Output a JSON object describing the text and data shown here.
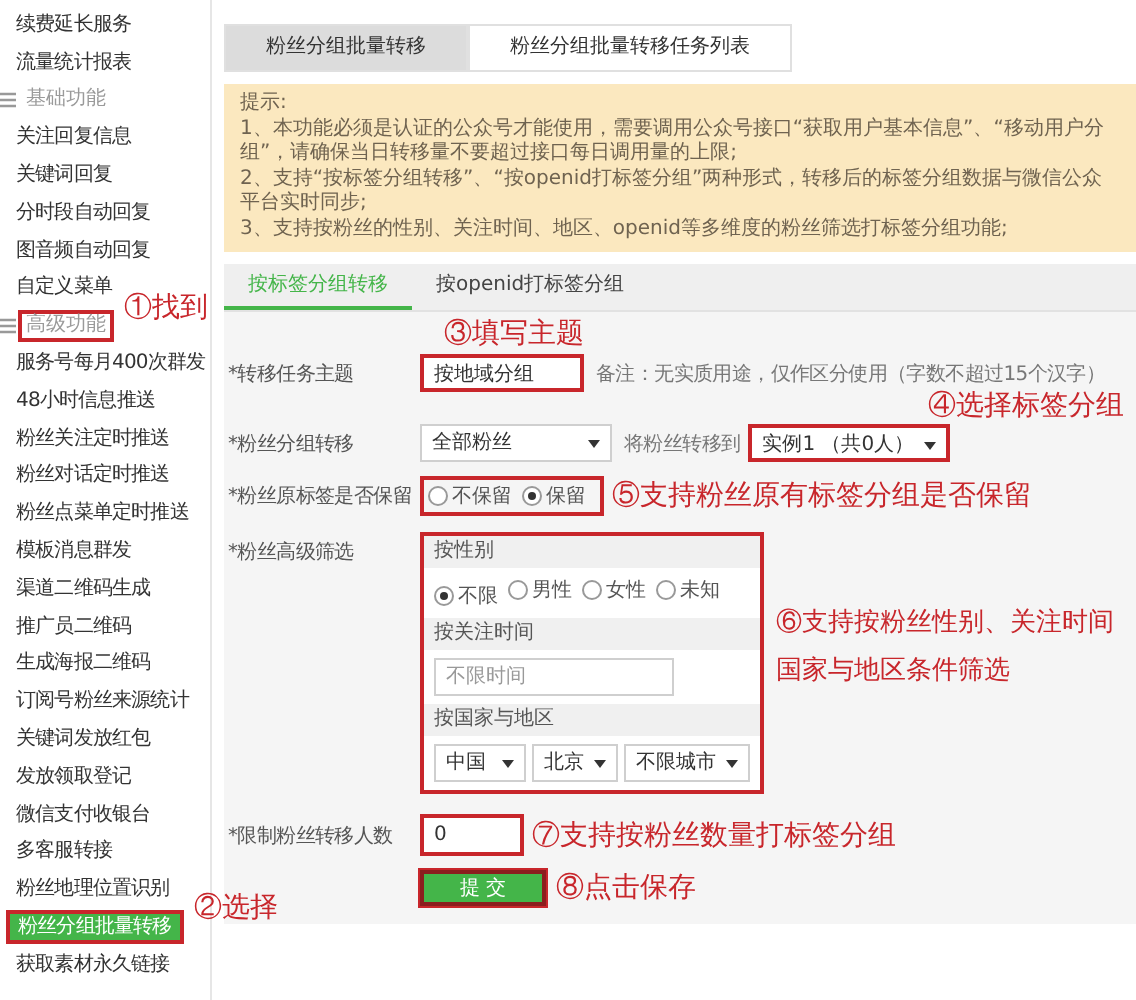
{
  "sidebar": {
    "items": [
      {
        "kind": "item",
        "label": "续费延长服务",
        "selected": false,
        "highlighted": false
      },
      {
        "kind": "item",
        "label": "流量统计报表",
        "selected": false,
        "highlighted": false
      },
      {
        "kind": "section",
        "label": "基础功能",
        "highlighted": false
      },
      {
        "kind": "item",
        "label": "关注回复信息",
        "selected": false,
        "highlighted": false
      },
      {
        "kind": "item",
        "label": "关键词回复",
        "selected": false,
        "highlighted": false
      },
      {
        "kind": "item",
        "label": "分时段自动回复",
        "selected": false,
        "highlighted": false
      },
      {
        "kind": "item",
        "label": "图音频自动回复",
        "selected": false,
        "highlighted": false
      },
      {
        "kind": "item",
        "label": "自定义菜单",
        "selected": false,
        "highlighted": false
      },
      {
        "kind": "section",
        "label": "高级功能",
        "highlighted": true,
        "annotation": "①找到"
      },
      {
        "kind": "item",
        "label": "服务号每月400次群发",
        "selected": false,
        "highlighted": false
      },
      {
        "kind": "item",
        "label": "48小时信息推送",
        "selected": false,
        "highlighted": false
      },
      {
        "kind": "item",
        "label": "粉丝关注定时推送",
        "selected": false,
        "highlighted": false
      },
      {
        "kind": "item",
        "label": "粉丝对话定时推送",
        "selected": false,
        "highlighted": false
      },
      {
        "kind": "item",
        "label": "粉丝点菜单定时推送",
        "selected": false,
        "highlighted": false
      },
      {
        "kind": "item",
        "label": "模板消息群发",
        "selected": false,
        "highlighted": false
      },
      {
        "kind": "item",
        "label": "渠道二维码生成",
        "selected": false,
        "highlighted": false
      },
      {
        "kind": "item",
        "label": "推广员二维码",
        "selected": false,
        "highlighted": false
      },
      {
        "kind": "item",
        "label": "生成海报二维码",
        "selected": false,
        "highlighted": false
      },
      {
        "kind": "item",
        "label": "订阅号粉丝来源统计",
        "selected": false,
        "highlighted": false
      },
      {
        "kind": "item",
        "label": "关键词发放红包",
        "selected": false,
        "highlighted": false
      },
      {
        "kind": "item",
        "label": "发放领取登记",
        "selected": false,
        "highlighted": false
      },
      {
        "kind": "item",
        "label": "微信支付收银台",
        "selected": false,
        "highlighted": false
      },
      {
        "kind": "item",
        "label": "多客服转接",
        "selected": false,
        "highlighted": false
      },
      {
        "kind": "item",
        "label": "粉丝地理位置识别",
        "selected": false,
        "highlighted": false
      },
      {
        "kind": "item",
        "label": "粉丝分组批量转移",
        "selected": true,
        "highlighted": true,
        "annotation": "②选择"
      },
      {
        "kind": "item",
        "label": "获取素材永久链接",
        "selected": false,
        "highlighted": false
      }
    ]
  },
  "tabs": [
    {
      "label": "粉丝分组批量转移",
      "selected": true
    },
    {
      "label": "粉丝分组批量转移任务列表",
      "selected": false
    }
  ],
  "tip": {
    "title": "提示:",
    "lines": [
      "1、本功能必须是认证的公众号才能使用，需要调用公众号接口“获取用户基本信息”、“移动用户分组”，请确保当日转移量不要超过接口每日调用量的上限;",
      "2、支持“按标签分组转移”、“按openid打标签分组”两种形式，转移后的标签分组数据与微信公众平台实时同步;",
      "3、支持按粉丝的性别、关注时间、地区、openid等多维度的粉丝筛选打标签分组功能;"
    ]
  },
  "form": {
    "tabs": [
      {
        "label": "按标签分组转移",
        "selected": true
      },
      {
        "label": "按openid打标签分组",
        "selected": false
      }
    ],
    "subject": {
      "label": "*转移任务主题",
      "value": "按地域分组",
      "note": "备注：无实质用途，仅作区分使用（字数不超过15个汉字）",
      "highlighted": true,
      "annotation": "③填写主题"
    },
    "group_transfer": {
      "label": "*粉丝分组转移",
      "source": "全部粉丝",
      "target_label": "将粉丝转移到",
      "target": "实例1 （共0人）",
      "target_highlighted": true,
      "annotation": "④选择标签分组"
    },
    "keep_tags": {
      "label": "*粉丝原标签是否保留",
      "options": [
        {
          "label": "不保留",
          "selected": false
        },
        {
          "label": "保留",
          "selected": true
        }
      ],
      "highlighted": true,
      "annotation": "⑤支持粉丝原有标签分组是否保留"
    },
    "filter": {
      "label": "*粉丝高级筛选",
      "highlighted": true,
      "annotation": [
        "⑥支持按粉丝性别、关注时间",
        "国家与地区条件筛选"
      ],
      "gender": {
        "title": "按性别",
        "options": [
          {
            "label": "不限",
            "selected": true
          },
          {
            "label": "男性",
            "selected": false
          },
          {
            "label": "女性",
            "selected": false
          },
          {
            "label": "未知",
            "selected": false
          }
        ]
      },
      "follow_time": {
        "title": "按关注时间",
        "placeholder": "不限时间"
      },
      "region": {
        "title": "按国家与地区",
        "selects": [
          "中国",
          "北京",
          "不限城市"
        ]
      }
    },
    "limit": {
      "label": "*限制粉丝转移人数",
      "value": "0",
      "highlighted": true,
      "annotation": "⑦支持按粉丝数量打标签分组"
    },
    "submit": {
      "label": "提 交",
      "highlighted": true,
      "annotation": "⑧点击保存"
    }
  }
}
